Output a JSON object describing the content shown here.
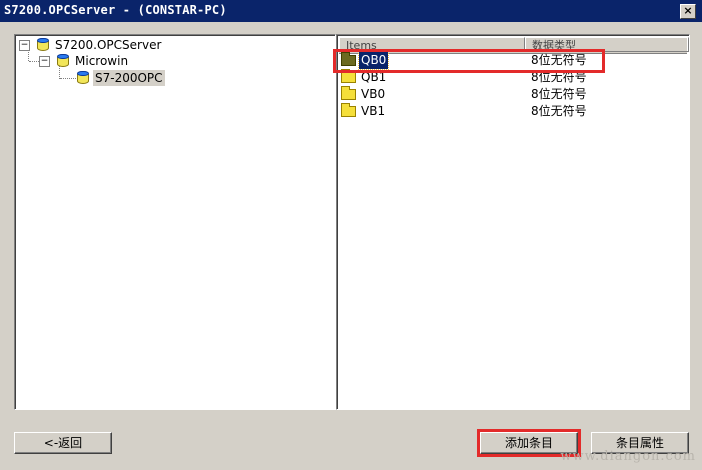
{
  "window": {
    "title": "S7200.OPCServer - (CONSTAR-PC)",
    "close_glyph": "×"
  },
  "tree": {
    "root": {
      "label": "S7200.OPCServer",
      "expander": "−"
    },
    "child": {
      "label": "Microwin",
      "expander": "−"
    },
    "leaf": {
      "label": "S7-200OPC"
    }
  },
  "list": {
    "columns": [
      "Items",
      "数据类型"
    ],
    "rows": [
      {
        "name": "QB0",
        "type": "8位无符号",
        "selected": true
      },
      {
        "name": "QB1",
        "type": "8位无符号",
        "selected": false
      },
      {
        "name": "VB0",
        "type": "8位无符号",
        "selected": false
      },
      {
        "name": "VB1",
        "type": "8位无符号",
        "selected": false
      }
    ]
  },
  "buttons": {
    "back": "<-返回",
    "add_item": "添加条目",
    "item_props": "条目属性"
  },
  "watermark": "www.diangon.com",
  "colors": {
    "title_bar": "#0a246a",
    "highlight": "#e32a2a",
    "selection": "#0a246a",
    "face": "#d4d0c8"
  }
}
